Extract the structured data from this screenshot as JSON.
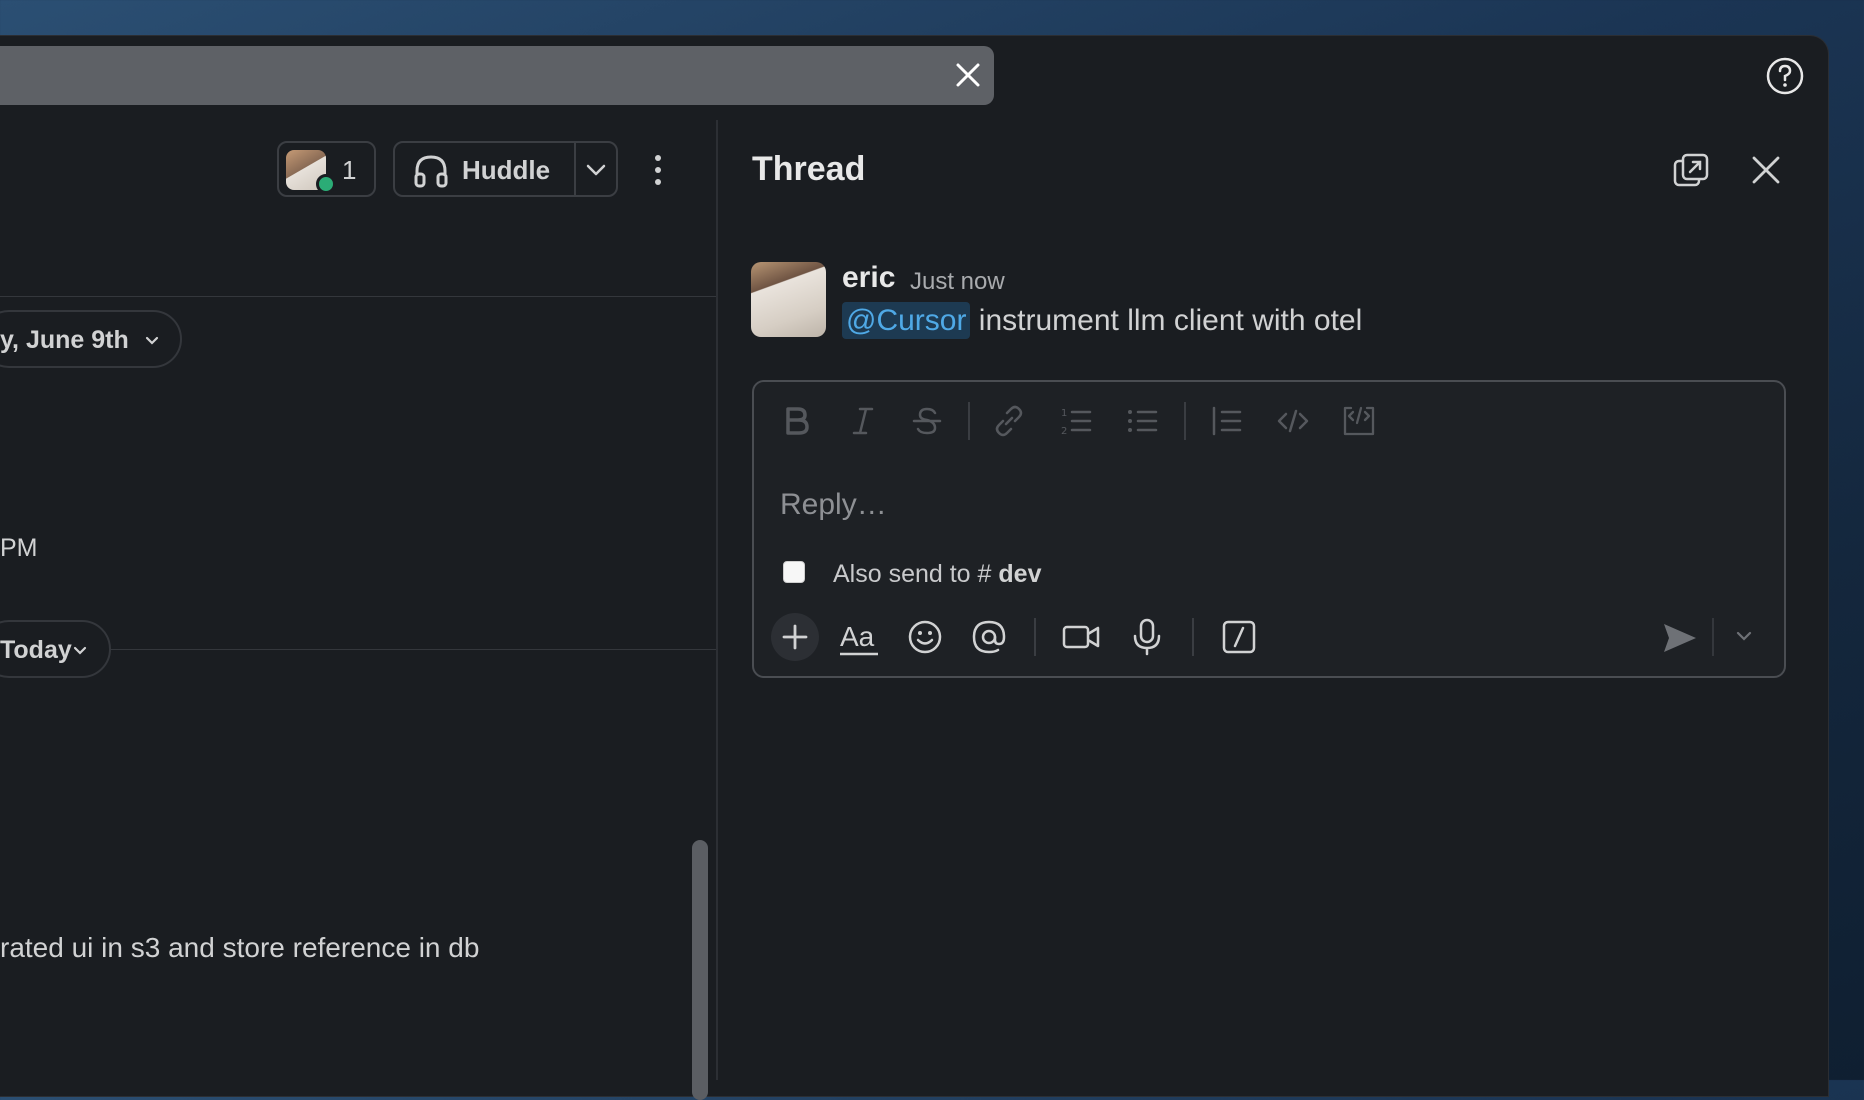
{
  "channel": {
    "members_count": "1",
    "huddle_label": "Huddle",
    "date_divider": "y, June 9th",
    "time_fragment": "PM",
    "today_divider": "Today",
    "message_fragment": "rated ui in s3 and store reference in db"
  },
  "thread": {
    "title": "Thread",
    "message": {
      "author": "eric",
      "timestamp": "Just now",
      "mention": "@Cursor",
      "text": " instrument llm client with otel"
    },
    "composer": {
      "placeholder": "Reply…",
      "also_send_prefix": "Also send to",
      "also_send_channel": "dev"
    }
  },
  "icons": {
    "format_toolbar": [
      "bold-icon",
      "italic-icon",
      "strikethrough-icon",
      "link-icon",
      "numbered-list-icon",
      "bulleted-list-icon",
      "blockquote-icon",
      "code-icon",
      "code-block-icon"
    ],
    "composer_toolbar": [
      "plus-icon",
      "text-format-icon",
      "emoji-icon",
      "mention-icon",
      "video-icon",
      "microphone-icon",
      "slash-command-icon",
      "send-icon"
    ]
  },
  "colors": {
    "background": "#1a1d21",
    "mention_bg": "#1d3a52",
    "mention_text": "#4fa9e6",
    "presence_green": "#2bac76"
  }
}
